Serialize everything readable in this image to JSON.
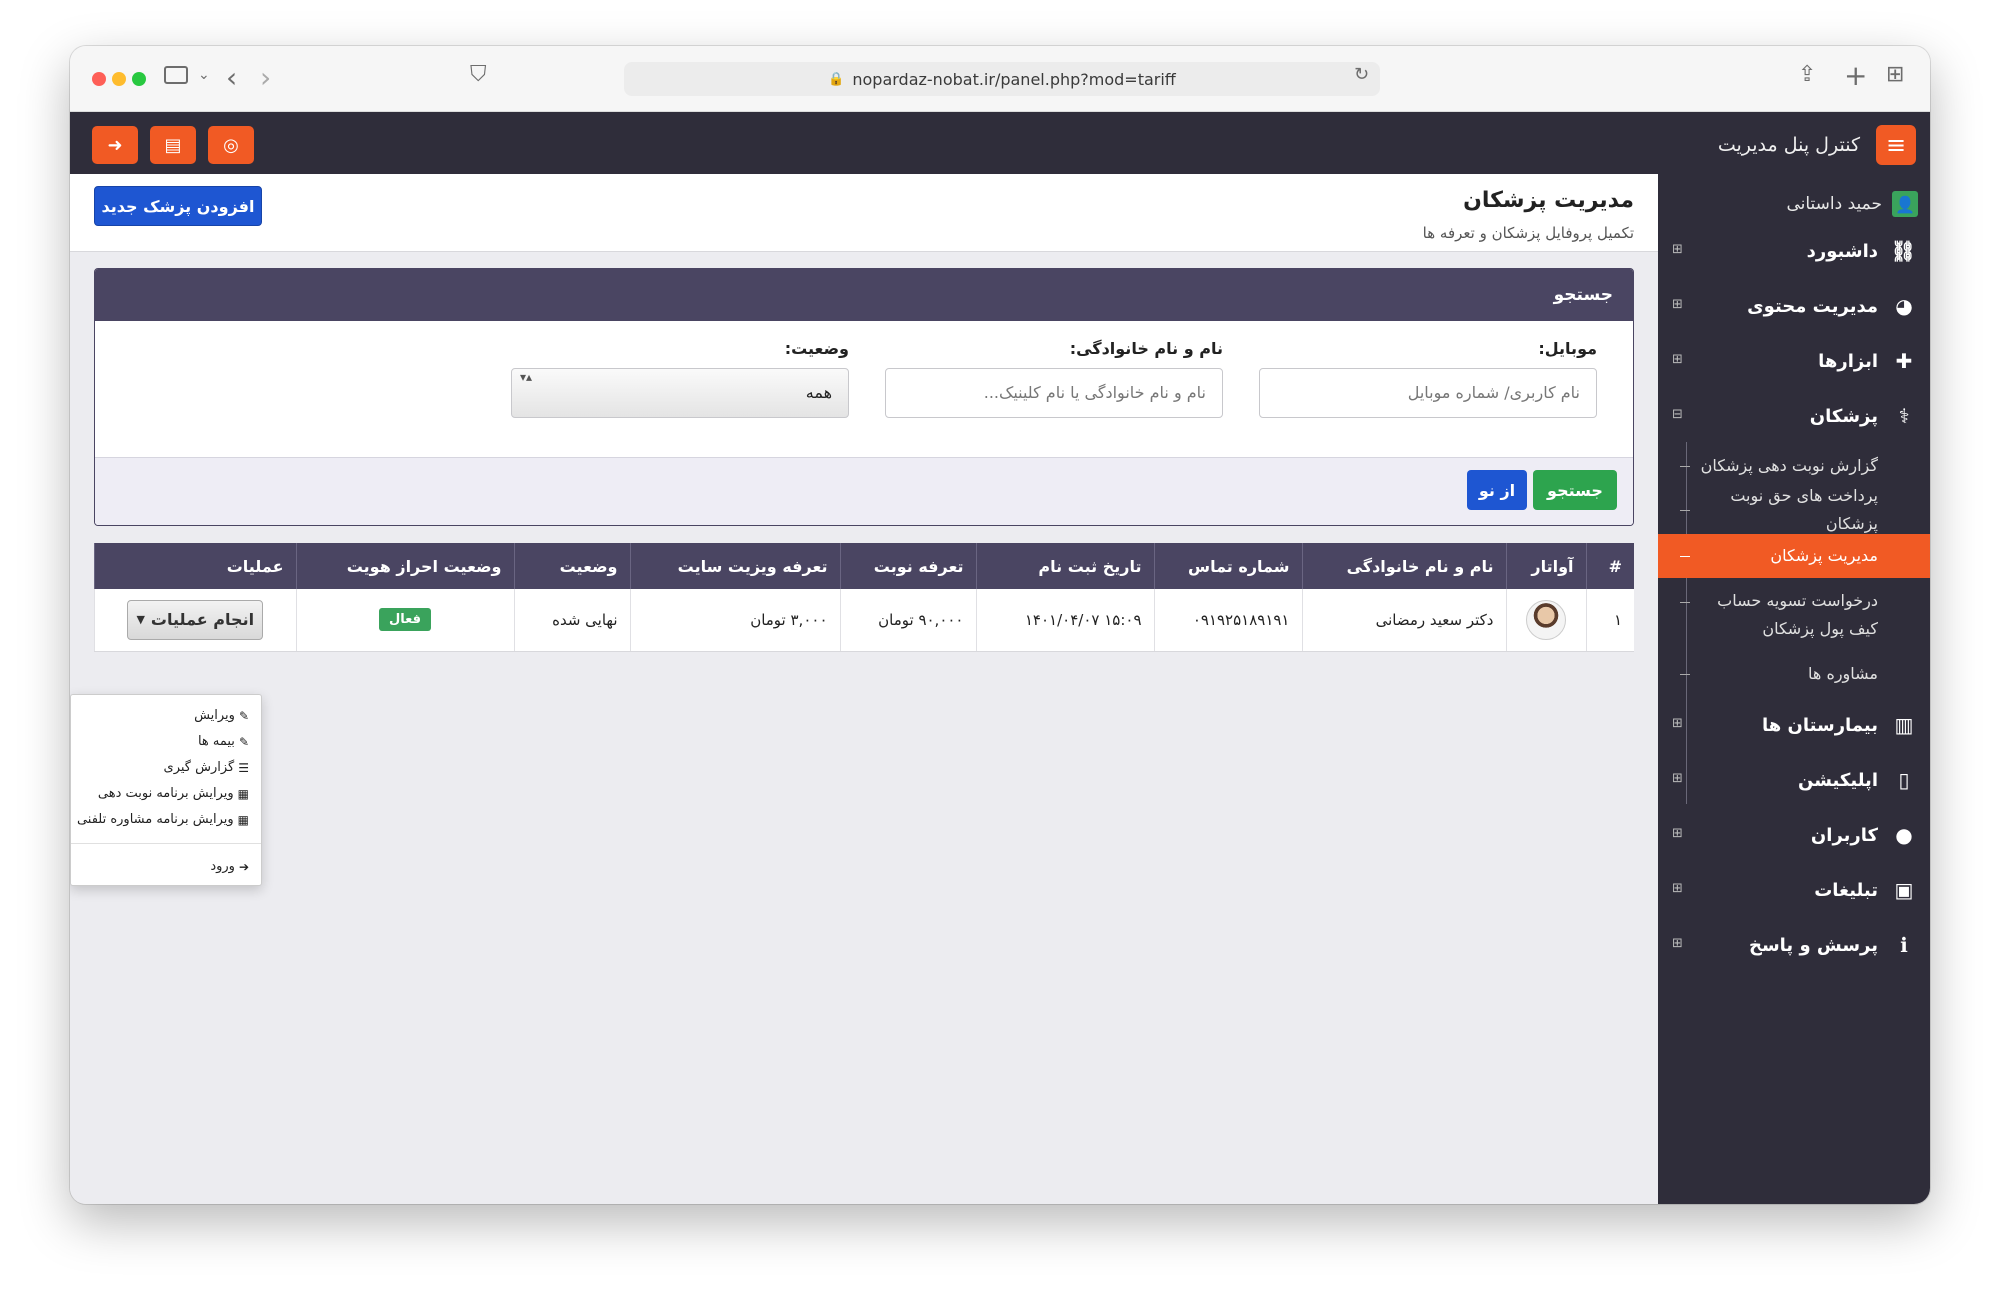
{
  "browser": {
    "url": "nopardaz-nobat.ir/panel.php?mod=tariff"
  },
  "topbar": {
    "title": "کنترل پنل مدیریت"
  },
  "sidebar": {
    "user_name": "حمید داستانی",
    "items": [
      {
        "label": "داشبورد",
        "icon": "sitemap-icon"
      },
      {
        "label": "مدیریت محتوی",
        "icon": "palette-icon"
      },
      {
        "label": "ابزارها",
        "icon": "puzzle-icon"
      },
      {
        "label": "پزشکان",
        "icon": "doctor-icon"
      },
      {
        "label": "بیمارستان ها",
        "icon": "hospital-icon"
      },
      {
        "label": "اپلیکیشن",
        "icon": "mobile-icon"
      },
      {
        "label": "کاربران",
        "icon": "user-icon"
      },
      {
        "label": "تبلیغات",
        "icon": "image-icon"
      },
      {
        "label": "پرسش و پاسخ",
        "icon": "info-icon"
      }
    ],
    "subitems": [
      {
        "label": "گزارش نوبت دهی پزشکان"
      },
      {
        "label": "پرداخت های حق نوبت پزشکان"
      },
      {
        "label": "مدیریت پزشکان"
      },
      {
        "label": "درخواست تسویه حساب کیف پول پزشکان"
      },
      {
        "label": "مشاوره ها"
      }
    ]
  },
  "header": {
    "title": "مدیریت پزشکان",
    "subtitle": "تکمیل پروفایل پزشکان و تعرفه ها",
    "add_button": "افزودن پزشک جدید"
  },
  "search": {
    "title": "جستجو",
    "mobile_label": "موبایل:",
    "mobile_placeholder": "نام کاربری/ شماره موبایل",
    "name_label": "نام و نام خانوادگی:",
    "name_placeholder": "نام و نام خانوادگی یا نام کلینیک...",
    "status_label": "وضعیت:",
    "status_value": "همه",
    "search_button": "جستجو",
    "reset_button": "از نو"
  },
  "table": {
    "headers": [
      "#",
      "آواتار",
      "نام و نام خانوادگی",
      "شماره تماس",
      "تاریخ ثبت نام",
      "تعرفه نوبت",
      "تعرفه ویزیت سایت",
      "وضعیت",
      "وضعیت احراز هویت",
      "عملیات"
    ],
    "rows": [
      {
        "index": "۱",
        "name": "دکتر سعید رمضانی",
        "phone": "۰۹۱۹۲۵۱۸۹۱۹۱",
        "date": "۱۵:۰۹ ۱۴۰۱/۰۴/۰۷",
        "tariff": "۹۰,۰۰۰ تومان",
        "visit_tariff": "۳,۰۰۰ تومان",
        "status": "نهایی شده",
        "auth_status": "فعال",
        "action_button": "انجام عملیات"
      }
    ]
  },
  "dropdown": {
    "items": [
      "ویرایش",
      "بیمه ها",
      "گزارش گیری",
      "ویرایش برنامه نوبت دهی",
      "ویرایش برنامه مشاوره تلفنی"
    ],
    "login": "ورود"
  },
  "colors": {
    "accent": "#f15a24",
    "dark": "#2f2d3a",
    "panel": "#4a4562",
    "primary": "#1e56d2",
    "success": "#2da44e"
  }
}
